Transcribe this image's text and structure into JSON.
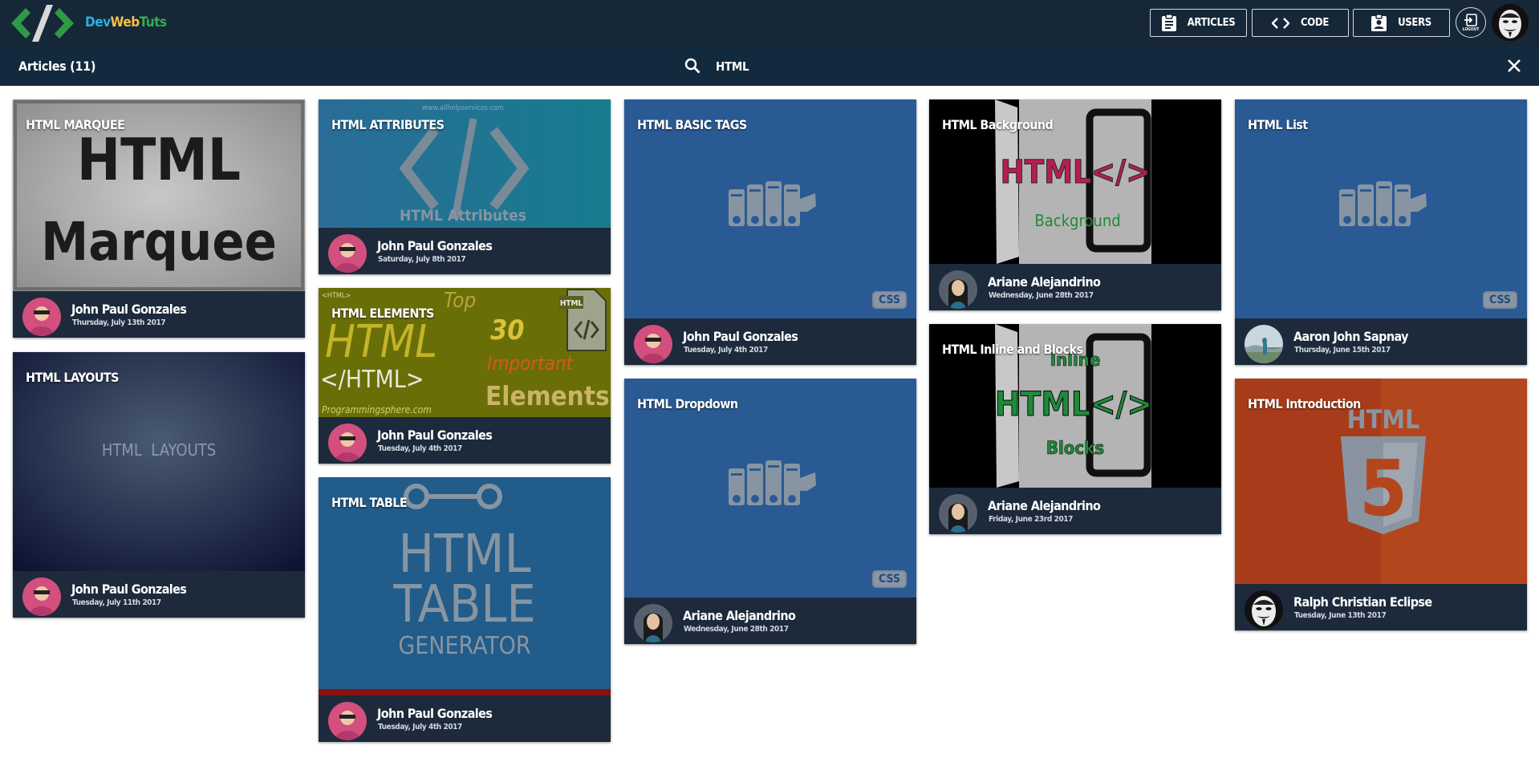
{
  "app": {
    "brand": {
      "dev": "Dev",
      "web": "Web",
      "tuts": "Tuts"
    },
    "nav": {
      "articles": "ARTICLES",
      "code": "CODE",
      "users": "USERS",
      "logout": "LOGOUT"
    }
  },
  "subbar": {
    "articles_count": "Articles (11)",
    "search_value": "HTML"
  },
  "colors": {
    "topbar": "#162738",
    "subbar": "#13293d",
    "card_footer": "#1c2a3b",
    "placeholder_blue": "#2a5a94"
  },
  "cards": [
    {
      "title": "HTML MARQUEE",
      "thumb_line1": "HTML",
      "thumb_line2": "Marquee",
      "author": "John Paul Gonzales",
      "date": "Thursday, July 13th 2017"
    },
    {
      "title": "HTML LAYOUTS",
      "thumb_text": "HTML  LAYOUTS",
      "author": "John Paul Gonzales",
      "date": "Tuesday, July 11th 2017"
    },
    {
      "title": "HTML ATTRIBUTES",
      "thumb_url": "www.allhelpservices.com",
      "thumb_caption": "HTML Attributes",
      "author": "John Paul Gonzales",
      "date": "Saturday, July 8th 2017"
    },
    {
      "title": "HTML ELEMENTS",
      "thumb_tag": "<HTML>",
      "thumb_top": "Top",
      "thumb_html": "HTML",
      "thumb_num": "30",
      "thumb_close": "</HTML>",
      "thumb_important": "Important",
      "thumb_elements": "Elements",
      "thumb_site": "Programmingsphere.com",
      "thumb_icon": "HTML",
      "author": "John Paul Gonzales",
      "date": "Tuesday, July 4th 2017"
    },
    {
      "title": "HTML TABLE",
      "thumb_line1": "HTML",
      "thumb_line2": "TABLE",
      "thumb_line3": "GENERATOR",
      "author": "John Paul Gonzales",
      "date": "Tuesday, July 4th 2017"
    },
    {
      "title": "HTML BASIC TAGS",
      "badge": "CSS",
      "author": "John Paul Gonzales",
      "date": "Tuesday, July 4th 2017"
    },
    {
      "title": "HTML Dropdown",
      "badge": "CSS",
      "author": "Ariane Alejandrino",
      "date": "Wednesday, June 28th 2017"
    },
    {
      "title": "HTML Background",
      "thumb_main": "HTML</>",
      "thumb_sub": "Background",
      "author": "Ariane Alejandrino",
      "date": "Wednesday, June 28th 2017"
    },
    {
      "title": "HTML Inline and Blocks",
      "thumb_inline": "Inline",
      "thumb_main": "HTML</>",
      "thumb_blocks": "Blocks",
      "author": "Ariane Alejandrino",
      "date": "Friday, June 23rd 2017"
    },
    {
      "title": "HTML List",
      "badge": "CSS",
      "author": "Aaron John Sapnay",
      "date": "Thursday, June 15th 2017"
    },
    {
      "title": "HTML Introduction",
      "thumb_label": "HTML",
      "thumb_digit": "5",
      "author": "Ralph Christian Eclipse",
      "date": "Tuesday, June 13th 2017"
    }
  ]
}
